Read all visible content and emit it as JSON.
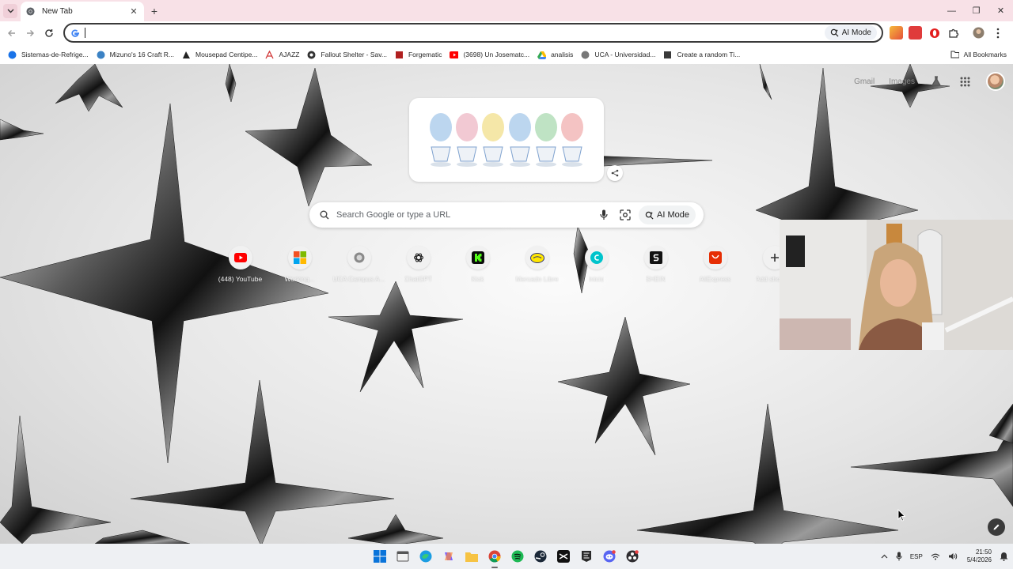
{
  "tabs": [
    {
      "title": "New Tab",
      "active": true,
      "icon": "chrome-icon"
    }
  ],
  "window_controls": {
    "minimize": "—",
    "restore": "❐",
    "close": "✕"
  },
  "omnibox": {
    "value": "",
    "placeholder": "",
    "ai_mode_label": "AI Mode"
  },
  "bookmarks": [
    {
      "label": "Sistemas-de-Refrige...",
      "icon": "site-icon",
      "color": "#1a73e8"
    },
    {
      "label": "Mizuno's 16 Craft R...",
      "icon": "site-icon",
      "color": "#3b82c4"
    },
    {
      "label": "Mousepad Centipe...",
      "icon": "site-icon",
      "color": "#222222"
    },
    {
      "label": "AJAZZ",
      "icon": "site-icon",
      "color": "#d23b3b"
    },
    {
      "label": "Fallout Shelter - Sav...",
      "icon": "site-icon",
      "color": "#333333"
    },
    {
      "label": "Forgematic",
      "icon": "site-icon",
      "color": "#b02020"
    },
    {
      "label": "(3698) Un Josematc...",
      "icon": "youtube-icon",
      "color": "#ff0000"
    },
    {
      "label": "analisis",
      "icon": "drive-icon",
      "color": "#34a853"
    },
    {
      "label": "UCA - Universidad...",
      "icon": "site-icon",
      "color": "#666666"
    },
    {
      "label": "Create a random Ti...",
      "icon": "site-icon",
      "color": "#3a3a3a"
    }
  ],
  "all_bookmarks_label": "All Bookmarks",
  "ntp": {
    "top_links": [
      "Gmail",
      "Images"
    ],
    "search_placeholder": "Search Google or type a URL",
    "ai_mode_label": "AI Mode",
    "shortcuts": [
      {
        "label": "(448) YouTube",
        "icon": "youtube-icon",
        "color": "#ff0000"
      },
      {
        "label": "Working...",
        "icon": "microsoft-icon",
        "color": "#f25022"
      },
      {
        "label": "UCA Campus A...",
        "icon": "site-icon",
        "color": "#777777"
      },
      {
        "label": "ChatGPT",
        "icon": "chatgpt-icon",
        "color": "#222222"
      },
      {
        "label": "Kick",
        "icon": "kick-icon",
        "color": "#53fc18"
      },
      {
        "label": "Mercado Libre",
        "icon": "mercadolibre-icon",
        "color": "#ffe600"
      },
      {
        "label": "Inicio",
        "icon": "canva-icon",
        "color": "#00c4cc"
      },
      {
        "label": "SHEIN",
        "icon": "shein-icon",
        "color": "#111111"
      },
      {
        "label": "AliExpress",
        "icon": "aliexpress-icon",
        "color": "#e62e04"
      },
      {
        "label": "Add shortcut",
        "icon": "plus-icon",
        "color": "#333333"
      }
    ]
  },
  "taskbar": {
    "apps": [
      "windows-start-icon",
      "file-explorer-icon",
      "edge-icon",
      "copilot-icon",
      "folder-icon",
      "chrome-icon",
      "spotify-icon",
      "steam-icon",
      "capcut-icon",
      "epic-games-icon",
      "discord-icon",
      "obs-icon"
    ],
    "language": "ESP",
    "time": "21:50",
    "date": "5/4/2026"
  },
  "colors": {
    "tabstrip": "#f8e1e7",
    "accent": "#1a73e8"
  }
}
